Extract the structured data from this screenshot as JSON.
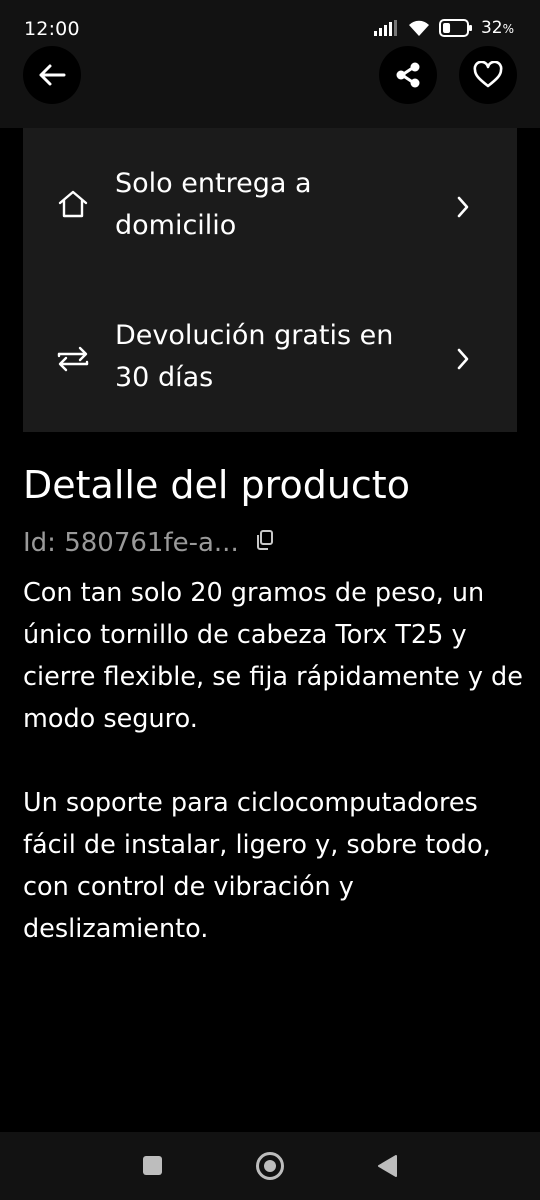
{
  "status": {
    "time": "12:00",
    "battery_percent": "32",
    "battery_level": 0.32
  },
  "top_bar": {
    "back_icon": "arrow-left-icon",
    "share_icon": "share-icon",
    "favorite_icon": "heart-icon"
  },
  "info_rows": [
    {
      "icon": "home-icon",
      "label": "Solo entrega a domicilio"
    },
    {
      "icon": "return-arrows-icon",
      "label": "Devolución gratis en 30 días"
    }
  ],
  "details": {
    "title": "Detalle del producto",
    "id_text": "Id: 580761fe-a...",
    "paragraphs": [
      "Con tan solo 20 gramos de peso, un único tornillo de cabeza Torx T25 y cierre flexible, se fija rápidamente y de modo seguro.",
      "Un soporte para ciclocomputadores fácil de instalar, ligero y, sobre todo, con control de vibración y deslizamiento."
    ]
  },
  "colors": {
    "background": "#000000",
    "card": "#1b1b1b",
    "bar": "#121212",
    "muted_text": "#9a9a9a"
  }
}
